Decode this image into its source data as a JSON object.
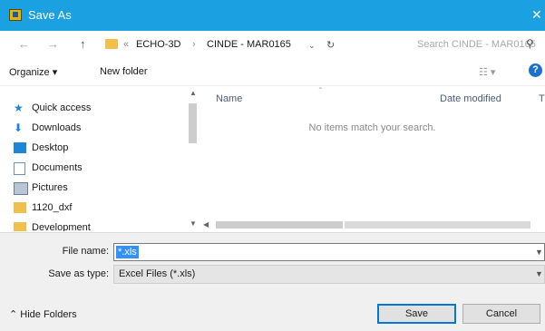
{
  "window": {
    "title": "Save As"
  },
  "address": {
    "overflow": "«",
    "crumbs": [
      "ECHO-3D",
      "CINDE - MAR0165"
    ],
    "separator": "›"
  },
  "search": {
    "placeholder": "Search CINDE - MAR0165"
  },
  "toolbar": {
    "organize": "Organize ▾",
    "new_folder": "New folder",
    "view": "☷ ▾",
    "help": "?"
  },
  "sidebar": {
    "items": [
      {
        "label": "Quick access"
      },
      {
        "label": "Downloads"
      },
      {
        "label": "Desktop"
      },
      {
        "label": "Documents"
      },
      {
        "label": "Pictures"
      },
      {
        "label": "1120_dxf"
      },
      {
        "label": "Development"
      }
    ]
  },
  "filelist": {
    "columns": {
      "name": "Name",
      "date_modified": "Date modified",
      "type": "T"
    },
    "empty_message": "No items match your search."
  },
  "form": {
    "file_name_label": "File name:",
    "file_name_value": "*.xls",
    "save_as_type_label": "Save as type:",
    "save_as_type_value": "Excel Files (*.xls)"
  },
  "footer": {
    "hide_folders": "Hide Folders",
    "save": "Save",
    "cancel": "Cancel"
  },
  "colors": {
    "titlebar": "#1ba1e2",
    "selection": "#3390ff",
    "accent": "#0078d7"
  }
}
